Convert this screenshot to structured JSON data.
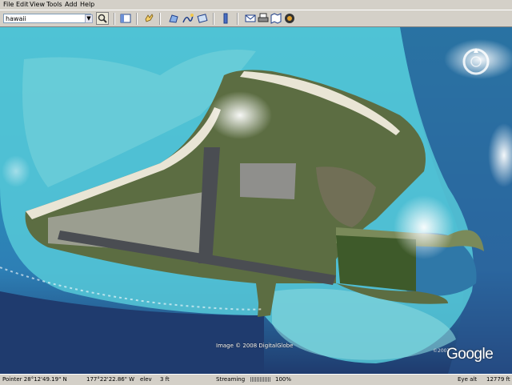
{
  "menu": {
    "items": [
      {
        "label": "File"
      },
      {
        "label": "Edit"
      },
      {
        "label": "View"
      },
      {
        "label": "Tools"
      },
      {
        "label": "Add"
      },
      {
        "label": "Help"
      }
    ]
  },
  "toolbar": {
    "search_value": "hawaii",
    "icons": [
      "search-icon",
      "sidebar-toggle-icon",
      "hand-navigate-icon",
      "add-polygon-icon",
      "add-path-icon",
      "add-overlay-icon",
      "ruler-icon",
      "email-icon",
      "print-icon",
      "map-view-icon",
      "google-maps-icon"
    ]
  },
  "map": {
    "copyright": "Image © 2008 DigitalGlobe",
    "google_logo": "Google",
    "small_copy": "©2007",
    "colors": {
      "ocean_deep": "#1f3b6e",
      "lagoon": "#4cc6d6",
      "reef": "#7fd6dc",
      "land": "#5a6a3e",
      "sand": "#e9e5d5"
    }
  },
  "status": {
    "pointer": "Pointer  28°12'49.19\" N",
    "longitude": "177°22'22.86\" W",
    "elev_label": "elev",
    "elev_value": "3 ft",
    "streaming_label": "Streaming",
    "streaming_percent": "100%",
    "eye_alt_label": "Eye alt",
    "eye_alt_value": "12779 ft"
  }
}
